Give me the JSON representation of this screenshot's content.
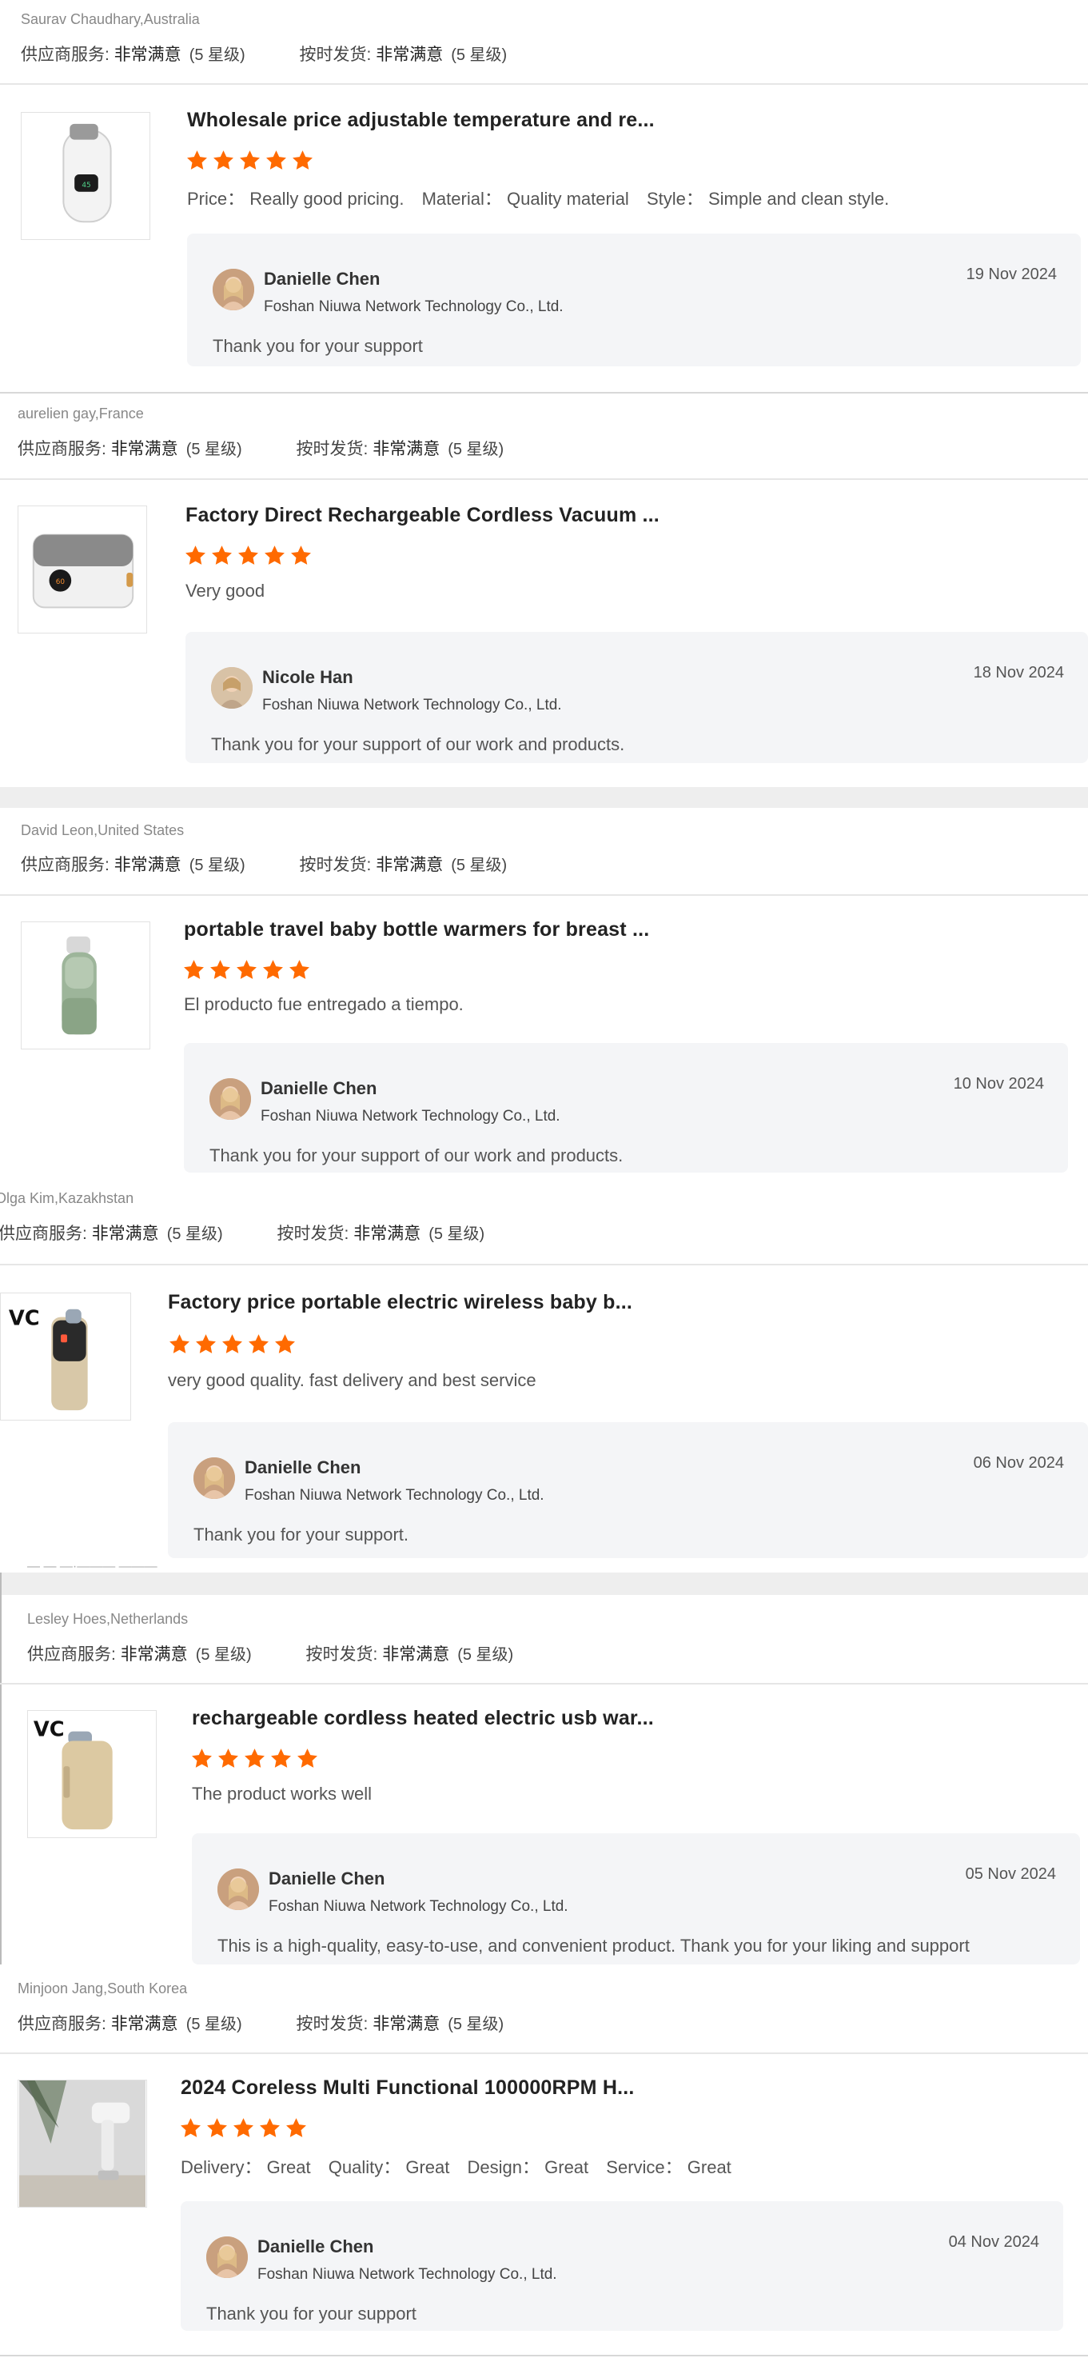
{
  "labels": {
    "supplier_service": "供应商服务:",
    "on_time_shipment": "按时发货:",
    "rating_value": "非常满意",
    "rating_level": "(5 星级)"
  },
  "colors": {
    "star": "#ff6a00",
    "reply_bg": "#f4f5f7"
  },
  "reviews": [
    {
      "reviewer": "Saurav Chaudhary,Australia",
      "product_title": "Wholesale price adjustable temperature and re...",
      "stars": 5,
      "comment": [
        {
          "k": "Price：",
          "v": "Really good pricing."
        },
        {
          "k": "Material：",
          "v": "Quality material"
        },
        {
          "k": "Style：",
          "v": "Simple and clean style."
        }
      ],
      "reply": {
        "name": "Danielle Chen",
        "company": "Foshan Niuwa Network Technology Co., Ltd.",
        "date": "19 Nov 2024",
        "text": "Thank you for your support"
      }
    },
    {
      "reviewer": "aurelien gay,France",
      "product_title": "Factory Direct Rechargeable Cordless Vacuum ...",
      "stars": 5,
      "comment_text": "Very good",
      "reply": {
        "name": "Nicole Han",
        "company": "Foshan Niuwa Network Technology Co., Ltd.",
        "date": "18 Nov 2024",
        "text": "Thank you for your support of our work and products."
      }
    },
    {
      "reviewer": "David Leon,United States",
      "product_title": "portable travel baby bottle warmers for breast ...",
      "stars": 5,
      "comment_text": "El producto fue entregado a tiempo.",
      "reply": {
        "name": "Danielle Chen",
        "company": "Foshan Niuwa Network Technology Co., Ltd.",
        "date": "10 Nov 2024",
        "text": "Thank you for your support of our work and products."
      }
    },
    {
      "reviewer": "Olga Kim,Kazakhstan",
      "product_title": "Factory price portable electric wireless baby b...",
      "stars": 5,
      "comment_text": "very good quality. fast delivery and best service",
      "reply": {
        "name": "Danielle Chen",
        "company": "Foshan Niuwa Network Technology Co., Ltd.",
        "date": "06 Nov 2024",
        "text": "Thank you for your support."
      }
    },
    {
      "reviewer": "Lesley Hoes,Netherlands",
      "product_title": "rechargeable cordless heated electric usb war...",
      "stars": 5,
      "comment_text": "The product works well",
      "reply": {
        "name": "Danielle Chen",
        "company": "Foshan Niuwa Network Technology Co., Ltd.",
        "date": "05 Nov 2024",
        "text": "This is a high-quality, easy-to-use, and convenient product. Thank you for your liking and support"
      }
    },
    {
      "reviewer": "Minjoon Jang,South Korea",
      "product_title": "2024 Coreless Multi Functional 100000RPM H...",
      "stars": 5,
      "comment": [
        {
          "k": "Delivery：",
          "v": "Great"
        },
        {
          "k": "Quality：",
          "v": "Great"
        },
        {
          "k": "Design：",
          "v": "Great"
        },
        {
          "k": "Service：",
          "v": "Great"
        }
      ],
      "reply": {
        "name": "Danielle Chen",
        "company": "Foshan Niuwa Network Technology Co., Ltd.",
        "date": "04 Nov 2024",
        "text": "Thank you for your support"
      }
    }
  ]
}
